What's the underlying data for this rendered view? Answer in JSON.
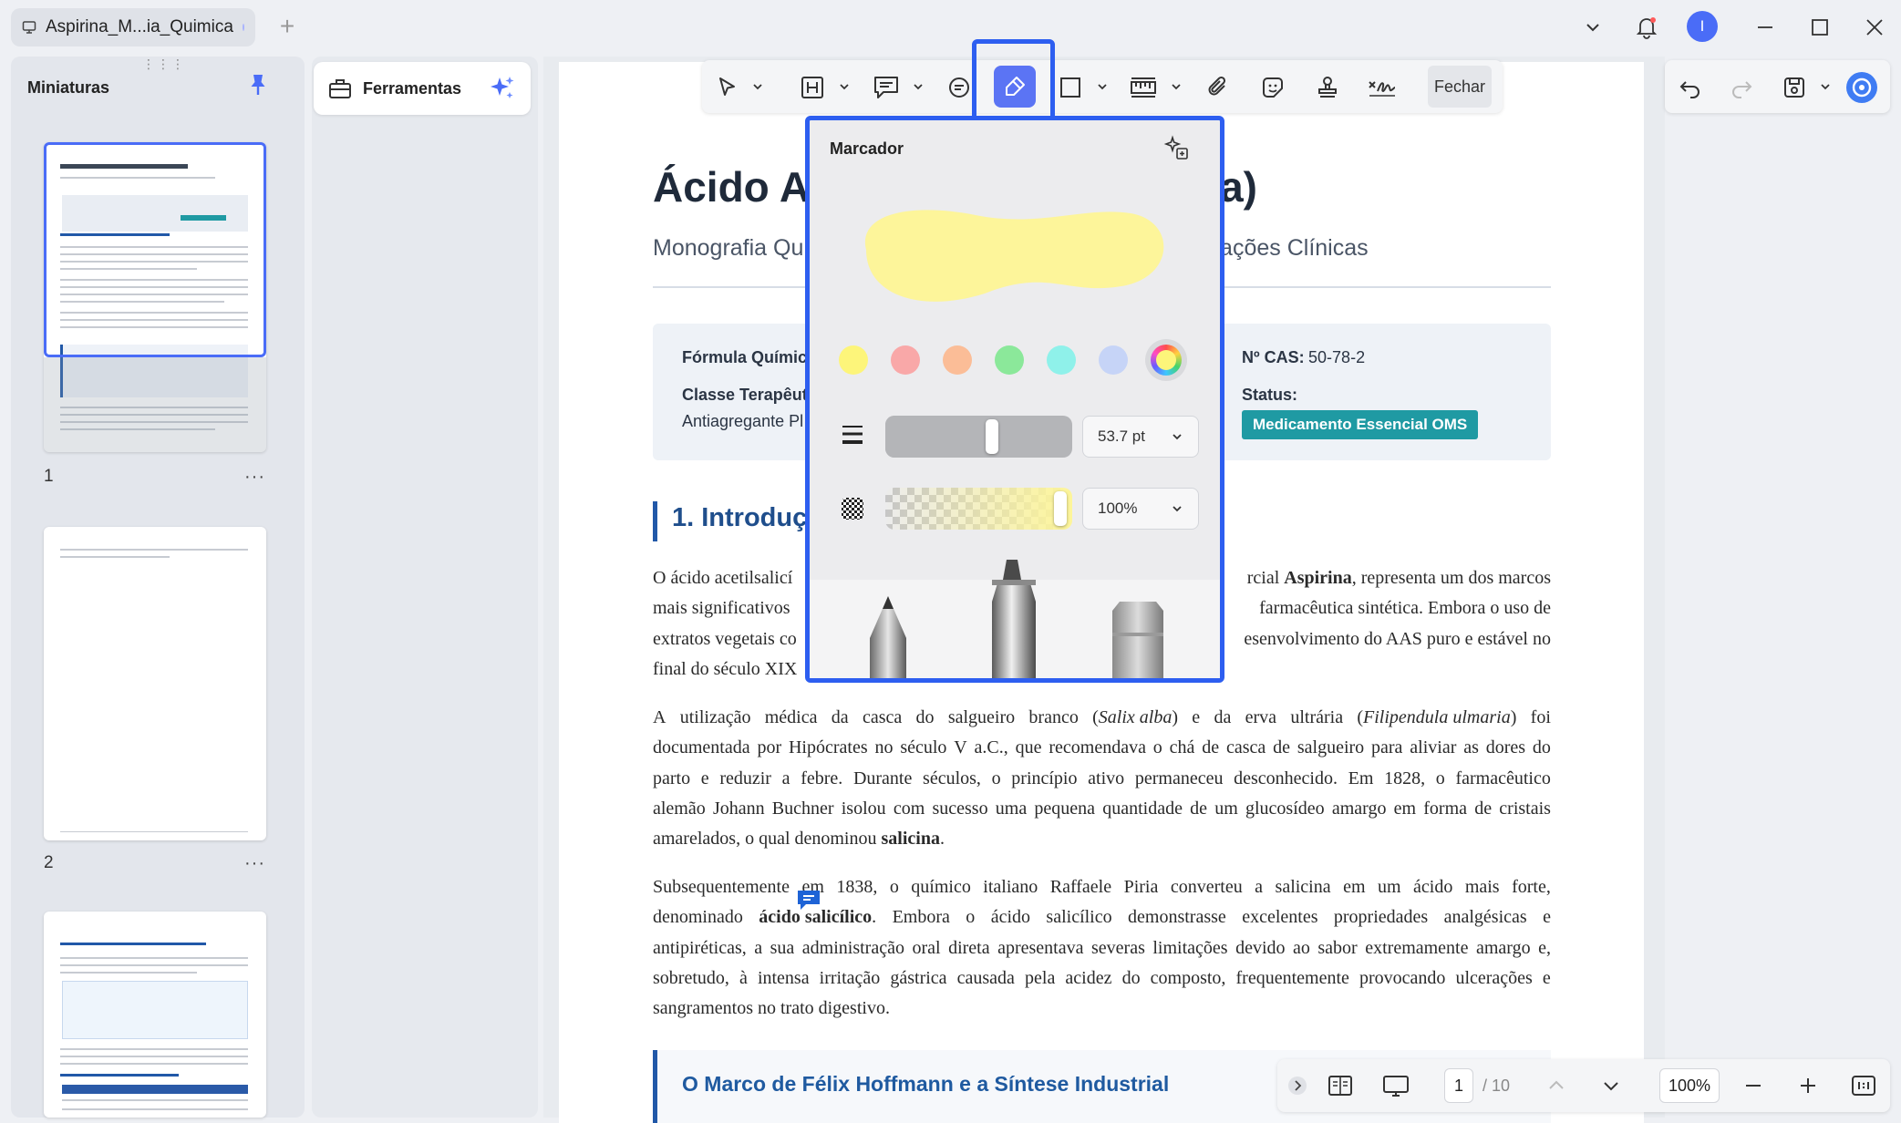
{
  "window": {
    "tab_title": "Aspirina_M...ia_Quimica",
    "avatar_initial": "I",
    "new_tab_symbol": "+"
  },
  "sidebar": {
    "title": "Miniaturas",
    "pages": [
      {
        "number": "1",
        "more": "···"
      },
      {
        "number": "2",
        "more": "···"
      }
    ]
  },
  "tools": {
    "label": "Ferramentas"
  },
  "toolbar": {
    "close_label": "Fechar",
    "accent_color": "#5b74f4"
  },
  "highlighter_popover": {
    "title": "Marcador",
    "stroke_color": "#fdf59a",
    "colors": [
      "#fdf57a",
      "#f9a8a8",
      "#fbbd97",
      "#8be89a",
      "#8ff1ea",
      "#c6d4f7",
      "rainbow"
    ],
    "selected_color_index": 6,
    "thickness_value": "53.7 pt",
    "thickness_fraction": 0.58,
    "opacity_value": "100%",
    "opacity_fraction": 1.0
  },
  "document": {
    "title_left": "Ácido A",
    "title_right": "na)",
    "subtitle_left": "Monografia Qu",
    "subtitle_right": "icações Clínicas",
    "info": {
      "formula_label": "Fórmula Químic",
      "class_label": "Classe Terapêut",
      "class_value": "Antiagregante Pl",
      "cas_label": "Nº CAS:",
      "cas_value": "50-78-2",
      "status_label": "Status:",
      "status_badge": "Medicamento Essencial OMS"
    },
    "section_title": "1. Introduç",
    "callout_title": "O Marco de Félix Hoffmann e a Síntese Industrial"
  },
  "bottom_nav": {
    "current_page": "1",
    "total_pages": "/ 10",
    "zoom": "100%"
  }
}
